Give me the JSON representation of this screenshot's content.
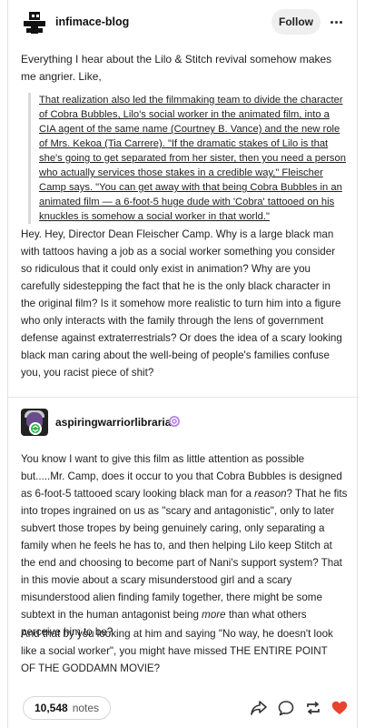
{
  "header": {
    "blog_name": "infimace-blog",
    "follow_label": "Follow",
    "avatar_icon": "robot-silhouette-icon",
    "more_icon": "more-options-icon"
  },
  "post": {
    "intro": "Everything I hear about the Lilo & Stitch revival somehow makes me angrier. Like,",
    "quote": "That realization also led the filmmaking team to divide the character of Cobra Bubbles, Lilo's social worker in the animated film, into a CIA agent of the same name (Courtney B. Vance) and the new role of Mrs. Kekoa (Tia Carrere). \"If the dramatic stakes of Lilo is that she's going to get separated from her sister, then you need a person who actually services those stakes in a credible way,\" Fleischer Camp says. \"You can get away with that being Cobra Bubbles in an animated film — a 6-foot-5 huge dude with 'Cobra' tattooed on his knuckles is somehow a social worker in that world.\"",
    "body": "Hey. Hey, Director Dean Fleischer Camp. Why is a large black man with tattoos having a job as a social worker something you consider so ridiculous that it could only exist in animation? Why are you carefully sidestepping the fact that he is the only black character in the original film? Is it somehow more realistic to turn him into a figure who only interacts with the family through the lens of government defense against extraterrestrials? Or does the idea of a scary looking black man caring about the well-being of people's families confuse you, you racist piece of shit?"
  },
  "reblog": {
    "user_name": "aspiringwarriorlibrarian",
    "badge_icon": "reblog-badge-icon",
    "emoji_icon": "purple-swirl-icon",
    "paragraph1_a": "You know I want to give this film as little attention as possible but.....Mr. Camp, does it occur to you that Cobra Bubbles is designed as 6-foot-5 tattooed scary looking black man for a ",
    "paragraph1_em1": "reason",
    "paragraph1_b": "? That he fits into tropes ingrained on us as \"scary and antagonistic\", only to later subvert those tropes by being genuinely caring, only separating a family when he feels he has to, and then helping Lilo keep Stitch at the end and choosing to become part of Nani's support system? That in this movie about a scary misunderstood girl and a scary misunderstood alien finding family together, there might be some subtext in the human antagonist being ",
    "paragraph1_em2": "more",
    "paragraph1_c": " than what others perceive him to be?",
    "paragraph2": "And that by you looking at him and saying \"No way, he doesn't look like a social worker\", you might have missed THE ENTIRE POINT OF THE GODDAMN MOVIE?"
  },
  "footer": {
    "notes_count": "10,548",
    "notes_label": "notes",
    "share_icon": "share-icon",
    "reply_icon": "reply-icon",
    "reblog_icon": "reblog-icon",
    "like_icon": "heart-icon",
    "like_color": "#e8442d"
  }
}
